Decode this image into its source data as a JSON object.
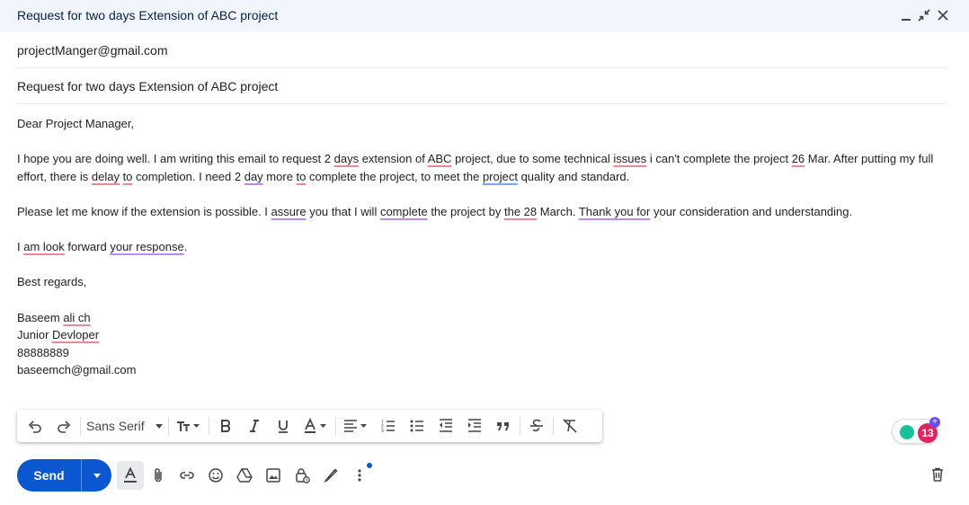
{
  "window": {
    "title": "Request for two days Extension of ABC project"
  },
  "compose": {
    "to": "projectManger@gmail.com",
    "subject": "Request for two days Extension of ABC project"
  },
  "body": {
    "greeting": "Dear Project Manager,",
    "p1": {
      "t1": "I hope you are doing well. I am writing this email to request 2 ",
      "days": "days",
      "t2": " extension of ",
      "abc": "ABC",
      "t3": " project, due to some technical ",
      "issues": "issues",
      "t4": " i can't complete the project ",
      "n26": "26",
      "t5": " Mar. After putting my full effort, there is ",
      "delay": "delay",
      "t6": " ",
      "to": "to",
      "t7": " completion. I need 2 ",
      "day": "day",
      "t8": " more ",
      "to2": "to",
      "t9": " complete the project, to meet the ",
      "project": "project",
      "t10": " quality and standard."
    },
    "p2": {
      "t1": "Please let me know if the extension is possible. I ",
      "assure": "assure",
      "t2": " you that I will ",
      "complete": "complete",
      "t3": " the project by ",
      "the28": "the 28",
      "t4": " March. ",
      "thankyoufor": "Thank you for",
      "t5": " your consideration and understanding."
    },
    "p3": {
      "t1": "I ",
      "amlook": "am look",
      "t2": " forward ",
      "yourresponse": "your response",
      "t3": "."
    },
    "closing": "Best regards,",
    "sig": {
      "name1": "Baseem ",
      "name2": "ali ch",
      "role1": "Junior ",
      "role2": "Devloper",
      "phone": "88888889",
      "email": "baseemch@gmail.com"
    }
  },
  "toolbar": {
    "font": "Sans Serif"
  },
  "grammarly": {
    "count": "13",
    "plus": "+"
  },
  "footer": {
    "send_label": "Send"
  },
  "colors": {
    "send_blue": "#0b57d0",
    "spell_red": "#e88a99",
    "grammar_purple": "#b98de8",
    "style_blue": "#7aa8ee",
    "grammarly_badge": "#e0245e"
  },
  "icons": [
    "minimize-icon",
    "exit-fullscreen-icon",
    "close-icon",
    "undo-icon",
    "redo-icon",
    "text-size-icon",
    "bold-icon",
    "italic-icon",
    "underline-icon",
    "text-color-icon",
    "align-icon",
    "numbered-list-icon",
    "bulleted-list-icon",
    "indent-less-icon",
    "indent-more-icon",
    "quote-icon",
    "strikethrough-icon",
    "remove-formatting-icon",
    "formatting-options-icon",
    "attach-icon",
    "link-icon",
    "emoji-icon",
    "drive-icon",
    "photo-icon",
    "confidential-icon",
    "signature-icon",
    "more-options-icon",
    "trash-icon"
  ]
}
